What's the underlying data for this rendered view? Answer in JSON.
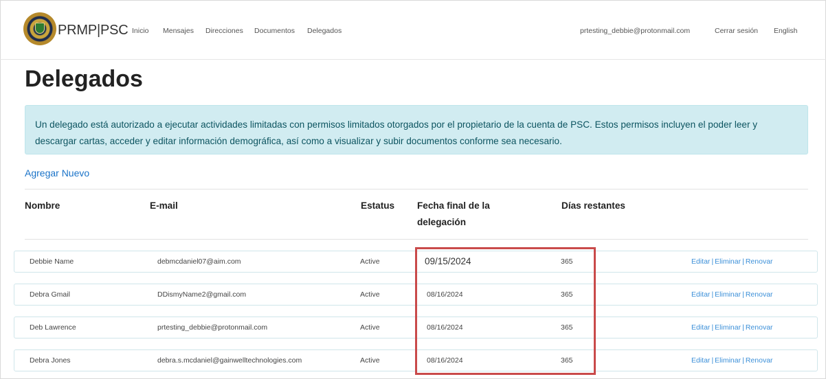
{
  "nav": {
    "brand": "PRMP|PSC",
    "links": [
      "Inicio",
      "Mensajes",
      "Direcciones",
      "Documentos",
      "Delegados"
    ],
    "user_email": "prtesting_debbie@protonmail.com",
    "logout": "Cerrar sesión",
    "language": "English"
  },
  "page": {
    "title": "Delegados",
    "info_line1": "Un delegado está autorizado a ejecutar actividades limitadas con permisos limitados otorgados por el propietario de la cuenta de PSC. Estos permisos incluyen el poder leer y",
    "info_line2": "descargar cartas, acceder y editar información demográfica, así como a visualizar y subir documentos conforme sea necesario.",
    "add_new": "Agregar Nuevo"
  },
  "table": {
    "headers": {
      "name": "Nombre",
      "email": "E-mail",
      "status": "Estatus",
      "end_date_1": "Fecha final de la",
      "end_date_2": "delegación",
      "days": "Días restantes"
    },
    "rows": [
      {
        "name": "Debbie Name",
        "email": "debmcdaniel07@aim.com",
        "status": "Active",
        "end_date": "09/15/2024",
        "days": "365"
      },
      {
        "name": "Debra Gmail",
        "email": "DDismyName2@gmail.com",
        "status": "Active",
        "end_date": "08/16/2024",
        "days": "365"
      },
      {
        "name": "Deb Lawrence",
        "email": "prtesting_debbie@protonmail.com",
        "status": "Active",
        "end_date": "08/16/2024",
        "days": "365"
      },
      {
        "name": "Debra Jones",
        "email": "debra.s.mcdaniel@gainwelltechnologies.com",
        "status": "Active",
        "end_date": "08/16/2024",
        "days": "365"
      }
    ],
    "actions": {
      "edit": "Editar",
      "delete": "Eliminar",
      "renew": "Renovar",
      "separator": "|"
    }
  },
  "colors": {
    "highlight": "#c94a4a",
    "info_bg": "#d1ecf1",
    "link": "#1a73c8"
  }
}
